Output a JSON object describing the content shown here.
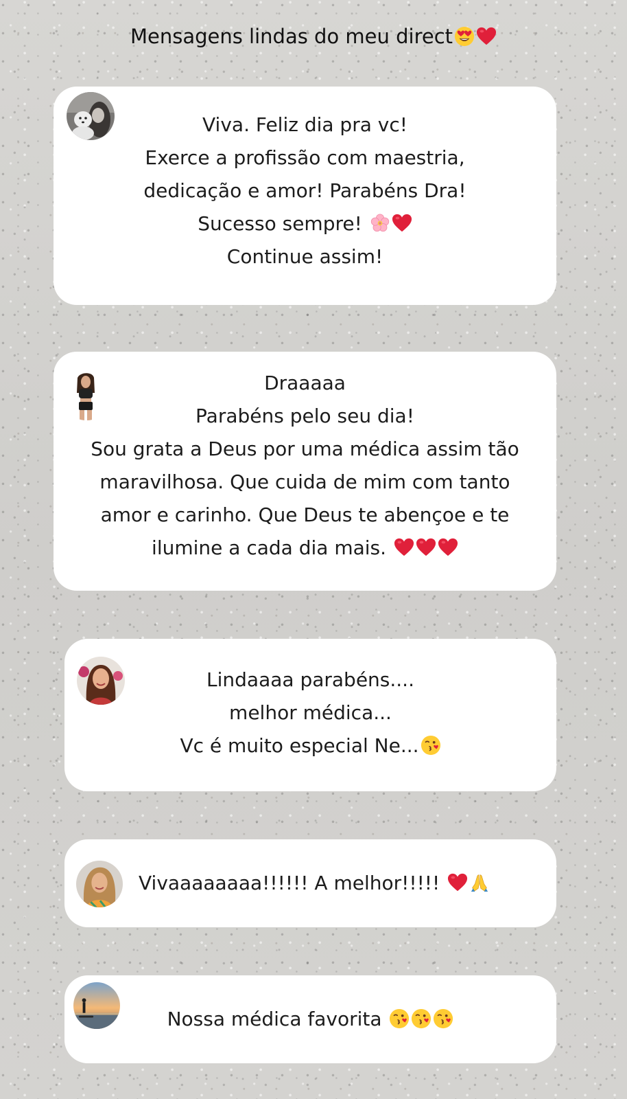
{
  "header": {
    "title": "Mensagens lindas do meu direct",
    "title_emojis": [
      "heart-eyes-emoji",
      "red-heart-emoji"
    ]
  },
  "messages": [
    {
      "lines": [
        "Viva. Feliz dia pra vc!",
        "Exerce a profissão com maestria,",
        "dedicação e amor! Parabéns Dra!",
        "Sucesso sempre!",
        "Continue assim!"
      ],
      "emojis": [
        "cherry-blossom-emoji",
        "red-heart-emoji"
      ]
    },
    {
      "lines": [
        "Draaaaa",
        "Parabéns pelo seu dia!",
        "Sou grata a Deus por uma médica assim tão",
        "maravilhosa. Que cuida de mim com tanto",
        "amor e carinho. Que Deus te abençoe e te",
        "ilumine a cada dia mais."
      ],
      "emojis": [
        "red-heart-emoji",
        "red-heart-emoji",
        "red-heart-emoji"
      ]
    },
    {
      "lines": [
        "Lindaaaa parabéns....",
        "melhor médica...",
        "Vc é muito especial Ne..."
      ],
      "emojis": [
        "kissing-face-emoji"
      ]
    },
    {
      "lines": [
        "Vivaaaaaaaa!!!!!! A melhor!!!!!"
      ],
      "emojis": [
        "red-heart-emoji",
        "folded-hands-emoji"
      ]
    },
    {
      "lines": [
        "Nossa médica favorita"
      ],
      "emojis": [
        "kissing-face-emoji",
        "kissing-face-emoji",
        "kissing-face-emoji"
      ]
    }
  ],
  "colors": {
    "background": "#d3d2cf",
    "card": "#ffffff",
    "text": "#1c1c1c",
    "heart": "#e0203a",
    "emoji_yellow": "#ffcc33"
  }
}
